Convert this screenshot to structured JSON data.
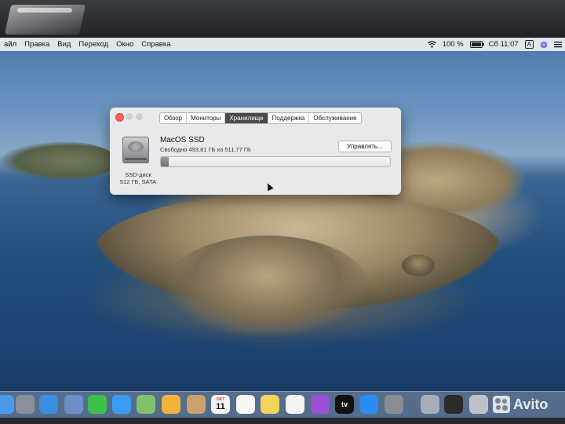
{
  "menubar": {
    "items": [
      "айл",
      "Правка",
      "Вид",
      "Переход",
      "Окно",
      "Справка"
    ],
    "battery_percent": "100 %",
    "battery_level": 1.0,
    "clock": "Сб 11:07",
    "input_source": "A"
  },
  "window": {
    "tabs": [
      "Обзор",
      "Мониторы",
      "Хранилище",
      "Поддержка",
      "Обслуживание"
    ],
    "active_tab": "Хранилище",
    "disk": {
      "name": "MacOS SSD",
      "free_text": "Свободно 493,81 ГБ из 511,77 ГБ",
      "free_gb": 493.81,
      "total_gb": 511.77,
      "type_label": "SSD-диск",
      "size_label": "512 ГБ, SATA"
    },
    "manage_button": "Управлять..."
  },
  "dock": {
    "apps": [
      {
        "name": "finder-icon",
        "color": "#4a9be8"
      },
      {
        "name": "launchpad-icon",
        "color": "#8a8f99"
      },
      {
        "name": "safari-icon",
        "color": "#3a8de0"
      },
      {
        "name": "mail-photo-icon",
        "color": "#6c8fc7"
      },
      {
        "name": "messages-icon",
        "color": "#3cc24c"
      },
      {
        "name": "messages-blue-icon",
        "color": "#3a9bf0"
      },
      {
        "name": "maps-icon",
        "color": "#7fc26a"
      },
      {
        "name": "photos-icon",
        "color": "#f2b33c"
      },
      {
        "name": "contacts-icon",
        "color": "#c9a36b"
      },
      {
        "name": "calendar-icon",
        "color": "#f4f4f4"
      },
      {
        "name": "reminders-icon",
        "color": "#f7f7f7"
      },
      {
        "name": "notes-icon",
        "color": "#f3d45a"
      },
      {
        "name": "music-icon",
        "color": "#f2f2f2"
      },
      {
        "name": "podcasts-icon",
        "color": "#9b4fd6"
      },
      {
        "name": "tv-icon",
        "color": "#111111"
      },
      {
        "name": "app-store-icon",
        "color": "#2a8cf0"
      },
      {
        "name": "system-preferences-icon",
        "color": "#8a8d93"
      },
      {
        "name": "disk-utility-icon",
        "color": "#a8adb5"
      },
      {
        "name": "terminal-icon",
        "color": "#2b2b2b"
      },
      {
        "name": "trash-icon",
        "color": "#bfc3c9"
      }
    ],
    "calendar_day": "11",
    "calendar_month": "OKT",
    "tv_label": "tv"
  },
  "watermark": "Avito"
}
